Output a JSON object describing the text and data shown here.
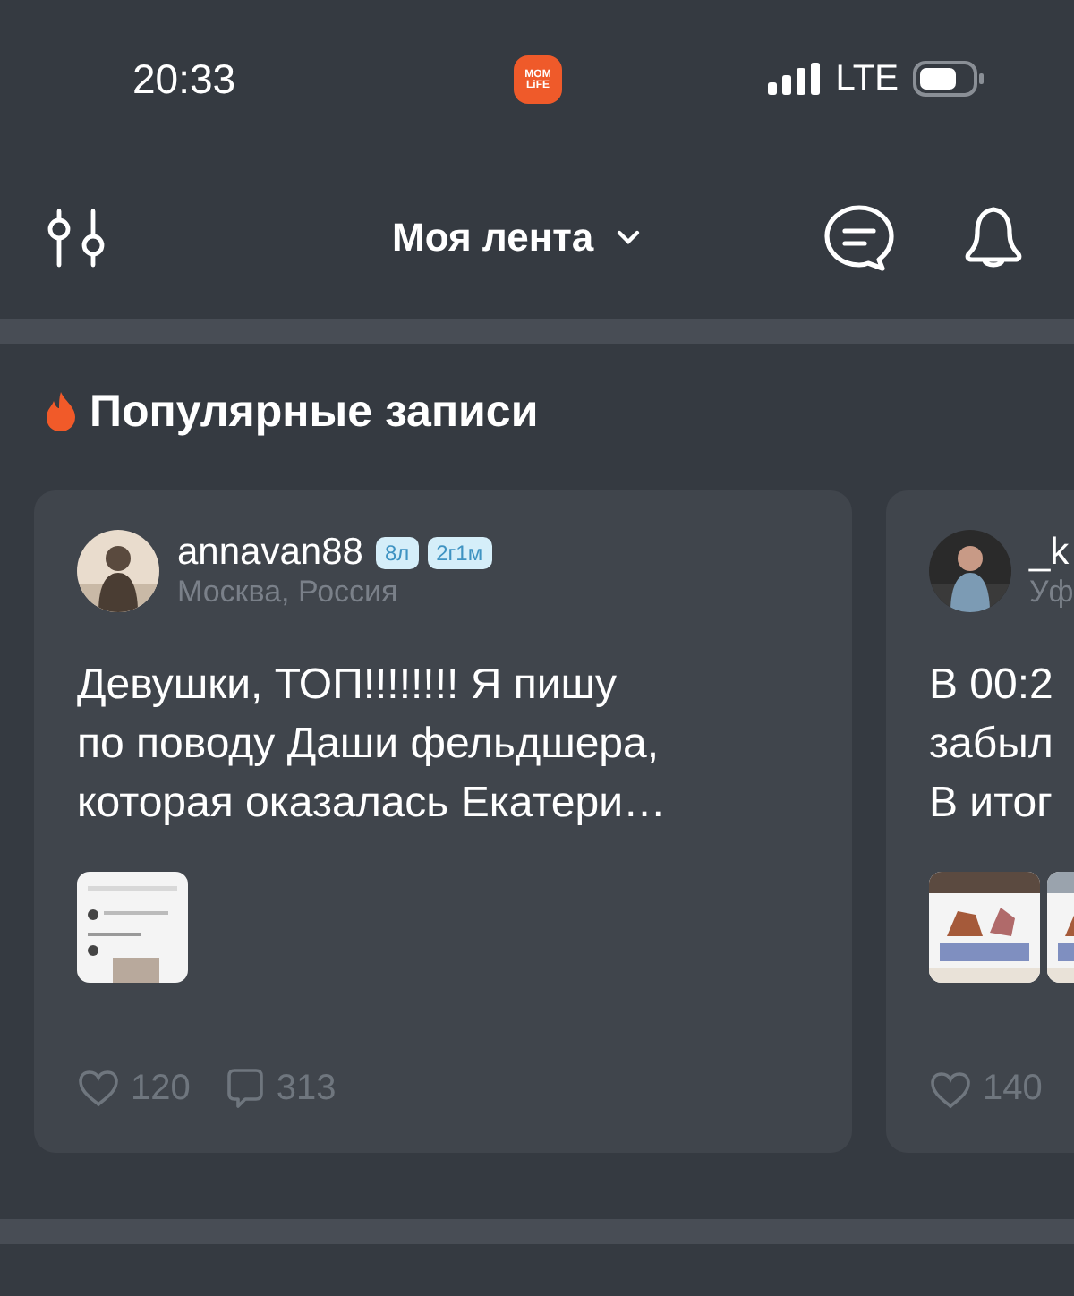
{
  "status_bar": {
    "time": "20:33",
    "app_logo": [
      "MOM",
      "LiFE"
    ],
    "network": "LTE"
  },
  "header": {
    "title": "Моя лента"
  },
  "section": {
    "title": "Популярные записи"
  },
  "posts": [
    {
      "username": "annavan88",
      "badges": [
        "8л",
        "2г1м"
      ],
      "location": "Москва, Россия",
      "lines": [
        "Девушки, ТОП!!!!!!!!  Я пишу",
        "по поводу Даши фельдшера,",
        "которая оказалась Екатери…"
      ],
      "images": [
        {
          "kind": "picture"
        }
      ],
      "likes": "120",
      "comments": "313"
    },
    {
      "username": "_k",
      "location": "Уф",
      "lines": [
        "В 00:2",
        "забыл",
        "В итог"
      ],
      "images": [
        {
          "kind": "picture"
        },
        {
          "kind": "picture"
        }
      ],
      "likes": "140"
    }
  ]
}
